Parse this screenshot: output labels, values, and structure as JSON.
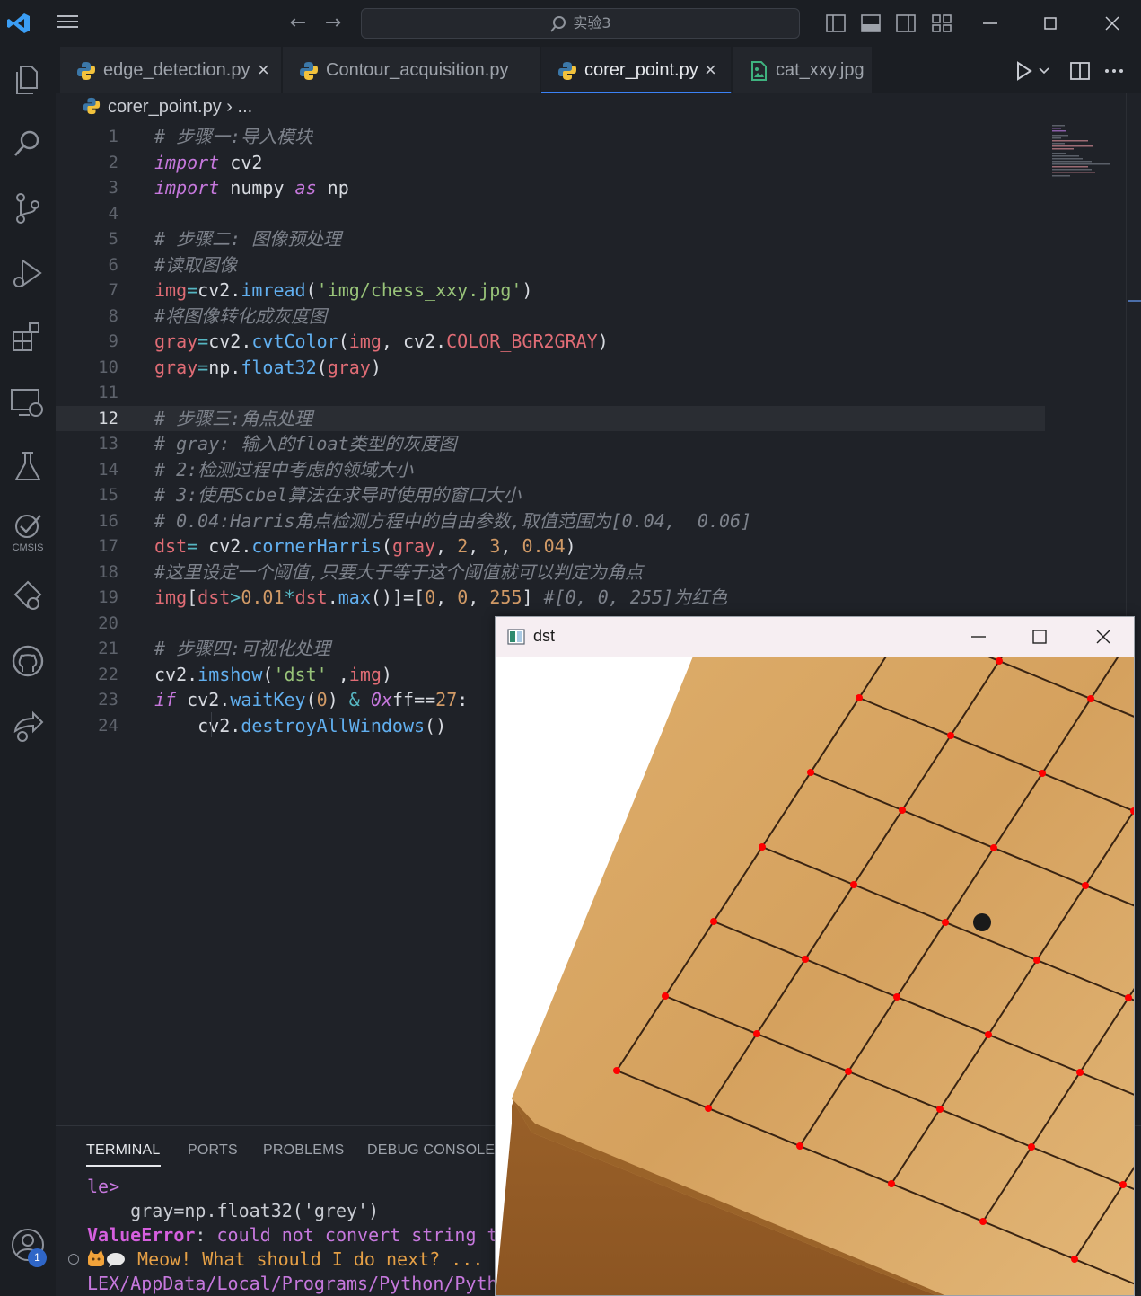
{
  "titlebar": {
    "search_text": "实验3"
  },
  "tabs": [
    {
      "label": "edge_detection.py",
      "active": false,
      "closable": true
    },
    {
      "label": "Contour_acquisition.py",
      "active": false,
      "closable": false
    },
    {
      "label": "corer_point.py",
      "active": true,
      "closable": true
    },
    {
      "label": "cat_xxy.jpg",
      "active": false,
      "closable": false
    }
  ],
  "breadcrumb": {
    "file": "corer_point.py",
    "rest": "..."
  },
  "activitybar": {
    "cmsis_label": "CMSIS",
    "badge_count": "1"
  },
  "editor": {
    "current_line": 12,
    "line_numbers": [
      "1",
      "2",
      "3",
      "4",
      "5",
      "6",
      "7",
      "8",
      "9",
      "10",
      "11",
      "12",
      "13",
      "14",
      "15",
      "16",
      "17",
      "18",
      "19",
      "20",
      "21",
      "22",
      "23",
      "24"
    ]
  },
  "panel": {
    "tabs": [
      "TERMINAL",
      "PORTS",
      "PROBLEMS",
      "DEBUG CONSOLE"
    ],
    "active_tab": "TERMINAL",
    "lines": [
      "le>",
      "    gray=np.float32('grey')",
      "could not convert string t",
      "Meow! What should I do next? ...",
      "LEX/AppData/Local/Programs/Python/Pyth"
    ],
    "error_type": "ValueError",
    "error_sep": ": "
  },
  "dst_window": {
    "title": "dst"
  },
  "colors": {
    "accent": "#3b82f6",
    "corner_marker": "#ff0000",
    "board": "#d7a660"
  }
}
